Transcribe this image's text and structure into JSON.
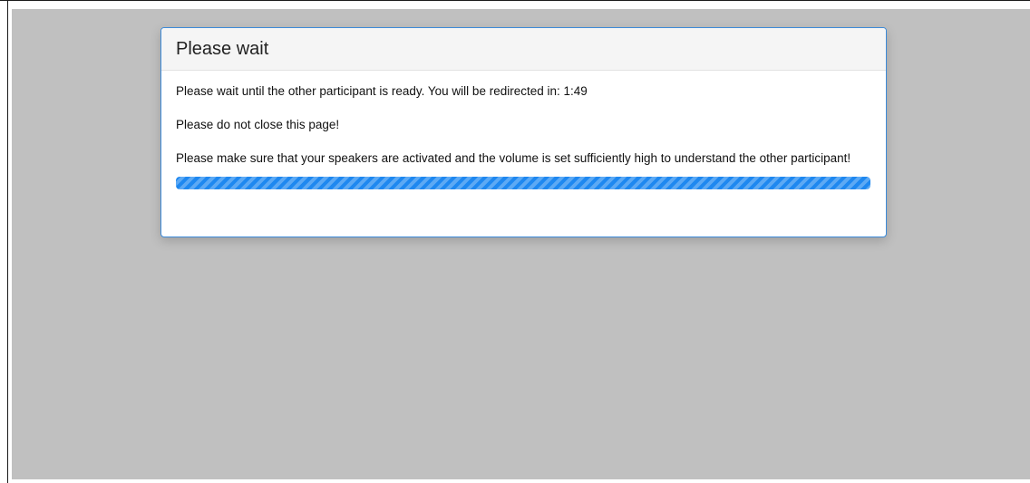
{
  "modal": {
    "title": "Please wait",
    "messages": [
      "Please wait until the other participant is ready. You will be redirected in: 1:49",
      "Please do not close this page!",
      "Please make sure that your speakers are activated and the volume is set sufficiently high to understand the other participant!"
    ],
    "progress": {
      "percent": 100,
      "style": "striped",
      "color": "#1e88f0"
    }
  },
  "colors": {
    "backdrop": "#c0c0c0",
    "modal_border": "#3c8ad8",
    "header_bg": "#f5f5f5"
  }
}
